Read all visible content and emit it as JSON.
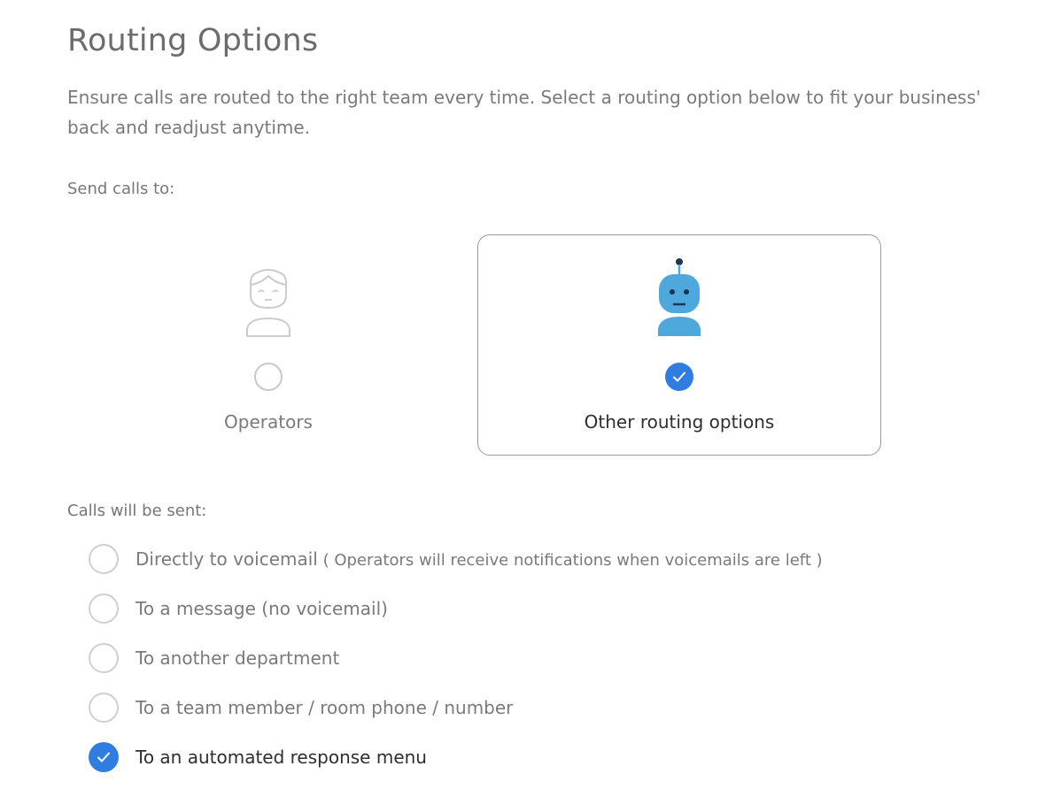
{
  "page": {
    "title": "Routing Options",
    "intro_line1": "Ensure calls are routed to the right team every time. Select a routing option below to fit your business'",
    "intro_line2": "back and readjust anytime."
  },
  "send": {
    "label": "Send calls to:",
    "cards": [
      {
        "label": "Operators",
        "icon": "operator-person-icon",
        "selected": false
      },
      {
        "label": "Other routing options",
        "icon": "robot-icon",
        "selected": true
      }
    ]
  },
  "calls": {
    "label": "Calls will be sent:",
    "options": [
      {
        "label": "Directly to voicemail",
        "note": " ( Operators will receive notifications when voicemails are left )",
        "selected": false
      },
      {
        "label": "To a message (no voicemail)",
        "note": "",
        "selected": false
      },
      {
        "label": "To another department",
        "note": "",
        "selected": false
      },
      {
        "label": "To a team member / room phone / number",
        "note": "",
        "selected": false
      },
      {
        "label": "To an automated response menu",
        "note": "",
        "selected": true
      }
    ]
  },
  "colors": {
    "accent": "#2f7de1",
    "robot": "#4fa8dc",
    "text_dark": "#2e2e2e",
    "text_muted": "#7a7a7a"
  }
}
